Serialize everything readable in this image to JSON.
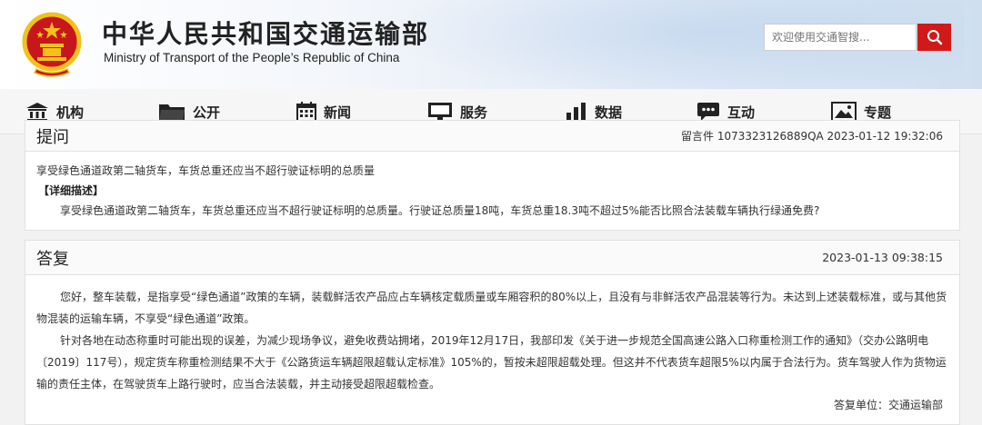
{
  "header": {
    "title": "中华人民共和国交通运输部",
    "subtitle": "Ministry of Transport of the People’s Republic of China",
    "search_placeholder": "欢迎使用交通智搜..."
  },
  "nav": [
    {
      "label": "机构",
      "icon": "institution-icon"
    },
    {
      "label": "公开",
      "icon": "folder-icon"
    },
    {
      "label": "新闻",
      "icon": "calendar-icon"
    },
    {
      "label": "服务",
      "icon": "monitor-icon"
    },
    {
      "label": "数据",
      "icon": "bar-chart-icon"
    },
    {
      "label": "互动",
      "icon": "chat-icon"
    },
    {
      "label": "专题",
      "icon": "image-icon"
    }
  ],
  "question": {
    "header_title": "提问",
    "meta": "留言件 1073323126889QA   2023-01-12 19:32:06",
    "title": "享受绿色通道政第二轴货车，车货总重还应当不超行驶证标明的总质量",
    "detail_label": "【详细描述】",
    "detail": "享受绿色通道政第二轴货车，车货总重还应当不超行驶证标明的总质量。行驶证总质量18吨，车货总重18.3吨不超过5%能否比照合法装载车辆执行绿通免费?"
  },
  "answer": {
    "header_title": "答复",
    "date": "2023-01-13 09:38:15",
    "paragraph1": "您好，整车装载，是指享受“绿色通道”政策的车辆，装载鲜活农产品应占车辆核定载质量或车厢容积的80%以上，且没有与非鲜活农产品混装等行为。未达到上述装载标准，或与其他货物混装的运输车辆，不享受“绿色通道”政策。",
    "paragraph2": "针对各地在动态称重时可能出现的误差，为减少现场争议，避免收费站拥堵，2019年12月17日，我部印发《关于进一步规范全国高速公路入口称重检测工作的通知》（交办公路明电〔2019〕117号），规定货车称重检测结果不大于《公路货运车辆超限超载认定标准》105%的，暂按未超限超载处理。但这并不代表货车超限5%以内属于合法行为。货车驾驶人作为货物运输的责任主体，在驾驶货车上路行驶时，应当合法装载，并主动接受超限超载检查。",
    "signature": "答复单位：交通运输部"
  },
  "colors": {
    "accent_red": "#d01a1a",
    "emblem_red": "#c8161d",
    "emblem_gold": "#f2c21b"
  }
}
